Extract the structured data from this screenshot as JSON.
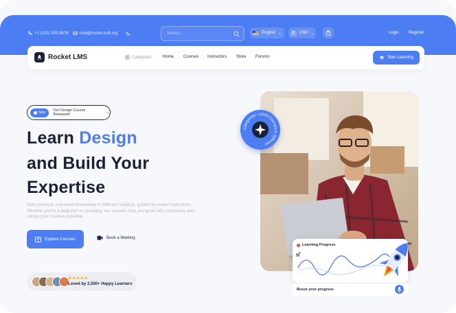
{
  "topbar": {
    "phone": "+1 (323) 555-9876",
    "email": "mail@rocket-soft.org",
    "search_placeholder": "Search...",
    "language": "English",
    "currency_symbol": "$",
    "currency": "USD",
    "login": "Login",
    "register": "Register"
  },
  "nav": {
    "brand": "Rocket LMS",
    "items": [
      "Categories",
      "Home",
      "Courses",
      "Instructors",
      "Store",
      "Forums"
    ],
    "cta": "Start Learning"
  },
  "hero": {
    "badge_new": "New",
    "badge_text": "Our Design Course Released!",
    "title_line1_a": "Learn ",
    "title_line1_b": "Design",
    "title_line2": "and Build Your",
    "title_line3": "Expertise",
    "description": "Gain practical, real-world knowledge in different subjects, guided by expert instructors. Whether you're a beginner or upskilling, our courses help you grow with confidence and unlock your creative potential.",
    "primary_button": "Explore Courses",
    "secondary_button": "Book a Meeting",
    "rating_stars": "★★★★★",
    "loved_text": "Loved by 2,500+ Happy Learners"
  },
  "visual": {
    "circle_badge_text": "Categories! • 2000 Courses in Different",
    "progress_title": "Learning Progress",
    "boost_text": "Boost your progress"
  },
  "colors": {
    "accent": "#4d7df2",
    "dark": "#1b2238"
  }
}
